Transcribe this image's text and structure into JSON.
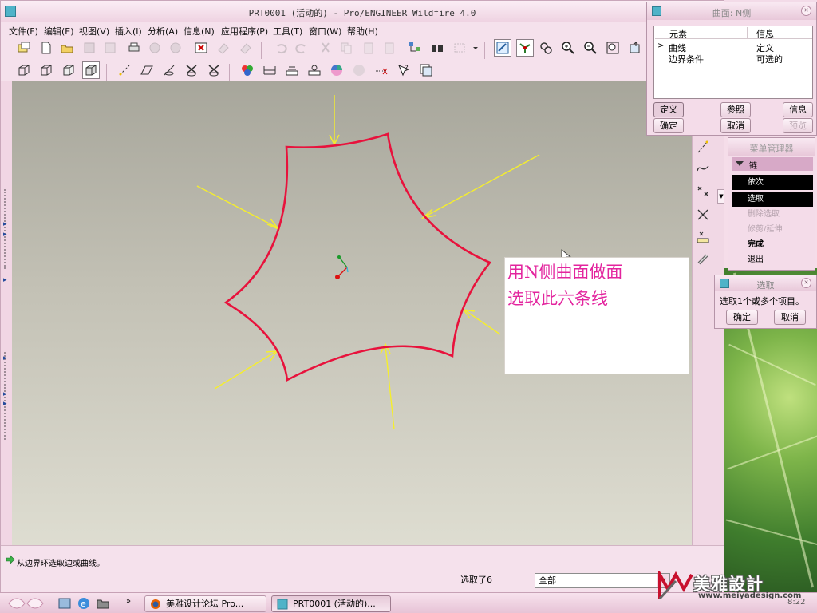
{
  "window": {
    "title": "PRT0001 (活动的) - Pro/ENGINEER Wildfire 4.0"
  },
  "menu": {
    "items": [
      "文件(F)",
      "编辑(E)",
      "视图(V)",
      "插入(I)",
      "分析(A)",
      "信息(N)",
      "应用程序(P)",
      "工具(T)",
      "窗口(W)",
      "帮助(H)"
    ]
  },
  "toolbar_top": {
    "icons": [
      "new-window-icon",
      "new-file-icon",
      "open-folder-icon",
      "save-icon",
      "save-copy-icon",
      "print-icon",
      "send-mail-icon",
      "email-icon",
      "close-window-icon",
      "erase-icon",
      "regenerate-icon",
      "undo-icon",
      "redo-icon",
      "cut-icon",
      "copy-icon",
      "paste-icon",
      "paste-special-icon",
      "model-tree-icon",
      "find-icon",
      "select-box-icon",
      "repaint-icon",
      "spin-center-icon",
      "orient-icon",
      "zoom-in-icon",
      "zoom-out-icon",
      "refit-icon",
      "saved-views-icon"
    ]
  },
  "toolbar_second": {
    "icons": [
      "wireframe-icon",
      "hidden-line-icon",
      "no-hidden-icon",
      "shading-icon",
      "datum-axes-icon",
      "datum-planes-icon",
      "datum-points-icon",
      "coord-sys-icon",
      "datum-csys-icon",
      "appearance-icon",
      "measure-icon",
      "section-icon",
      "mass-icon",
      "color-icon",
      "render-icon",
      "ruler-icon",
      "help-query-icon",
      "view-manager-icon"
    ]
  },
  "right_strip": {
    "icons": [
      "sketch-curve-icon",
      "spline-curve-icon",
      "datum-point-icon",
      "point-offset-icon",
      "csys-point-icon",
      "chain-link-icon"
    ]
  },
  "viewport": {
    "callout_lines": [
      "用N侧曲面做面",
      "选取此六条线"
    ],
    "curve_color": "#e8123c",
    "arrow_color": "#f5ee2c"
  },
  "status": {
    "message": "从边界环选取边或曲线。",
    "selection_count": "选取了6",
    "filter_value": "全部"
  },
  "nside_dialog": {
    "title": "曲面: N侧",
    "columns": [
      "元素",
      "信息"
    ],
    "rows": [
      {
        "element": "曲线",
        "info": "定义",
        "current": true
      },
      {
        "element": "边界条件",
        "info": "可选的",
        "current": false
      }
    ],
    "buttons": {
      "define": "定义",
      "reference": "参照",
      "info": "信息",
      "ok": "确定",
      "cancel": "取消",
      "preview": "预览"
    }
  },
  "menu_manager": {
    "title": "菜单管理器",
    "section": "链",
    "items": [
      {
        "label": "依次",
        "state": "selected"
      },
      {
        "label": "选取",
        "state": "selected"
      },
      {
        "label": "删除选取",
        "state": "disabled"
      },
      {
        "label": "修剪/延伸",
        "state": "disabled"
      },
      {
        "label": "完成",
        "state": "bold"
      },
      {
        "label": "退出",
        "state": "normal"
      }
    ]
  },
  "select_dialog": {
    "title": "选取",
    "prompt": "选取1个或多个项目。",
    "ok": "确定",
    "cancel": "取消"
  },
  "taskbar": {
    "apps": [
      {
        "label": "美雅设计论坛 Pro...",
        "icon": "firefox-icon",
        "active": false
      },
      {
        "label": "PRT0001 (活动的)...",
        "icon": "proe-icon",
        "active": true
      }
    ],
    "quick_expand": "»",
    "clock": "8:22"
  },
  "watermark": {
    "title": "美雅設計",
    "url": "www.meiyadesign.com"
  }
}
